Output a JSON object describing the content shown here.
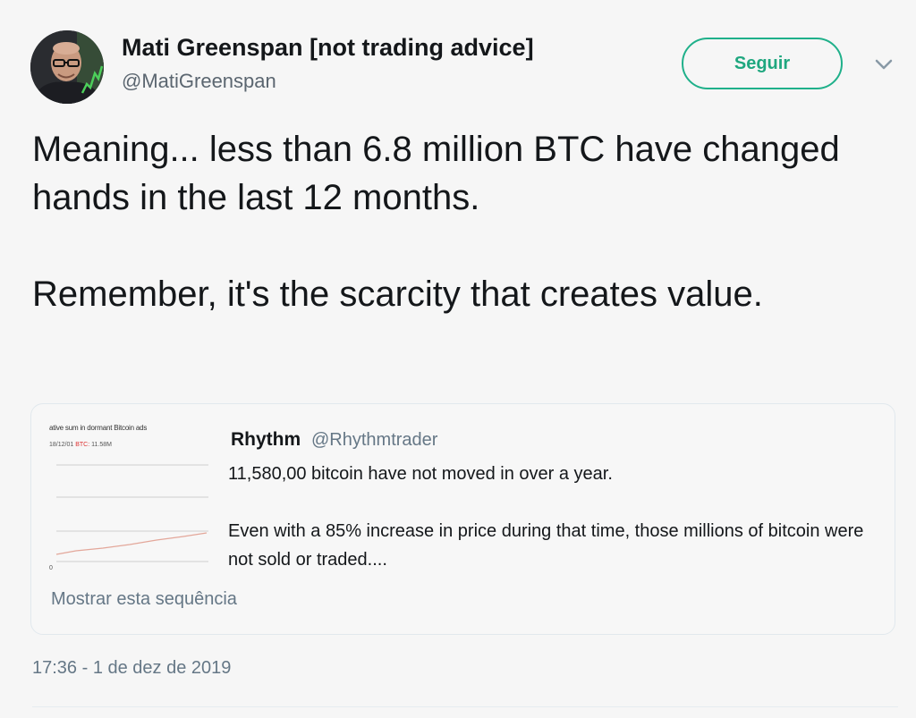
{
  "author": {
    "display_name": "Mati Greenspan [not trading advice]",
    "handle": "@MatiGreenspan",
    "avatar_icon": "user-avatar"
  },
  "follow_button": {
    "label": "Seguir"
  },
  "menu_icon": "chevron-down-icon",
  "tweet": {
    "paragraphs": [
      "Meaning... less than 6.8 million BTC have changed hands in the last 12 months.",
      "Remember, it's the scarcity that creates value."
    ]
  },
  "quoted_tweet": {
    "thumbnail": {
      "title": "ative sum in dormant Bitcoin ads",
      "date": "18/12/01",
      "series_label": "BTC:",
      "series_value": "11.58M",
      "axis_tick": "0"
    },
    "author_name": "Rhythm",
    "author_handle": "@Rhythmtrader",
    "paragraphs": [
      "11,580,00 bitcoin have not moved in over a year.",
      "Even with a 85% increase in price during that time, those millions of bitcoin were not sold or traded...."
    ],
    "show_thread": "Mostrar esta sequência"
  },
  "timestamp": "17:36 - 1 de dez de 2019",
  "colors": {
    "accent": "#1fa77f",
    "secondary_text": "#657786"
  }
}
